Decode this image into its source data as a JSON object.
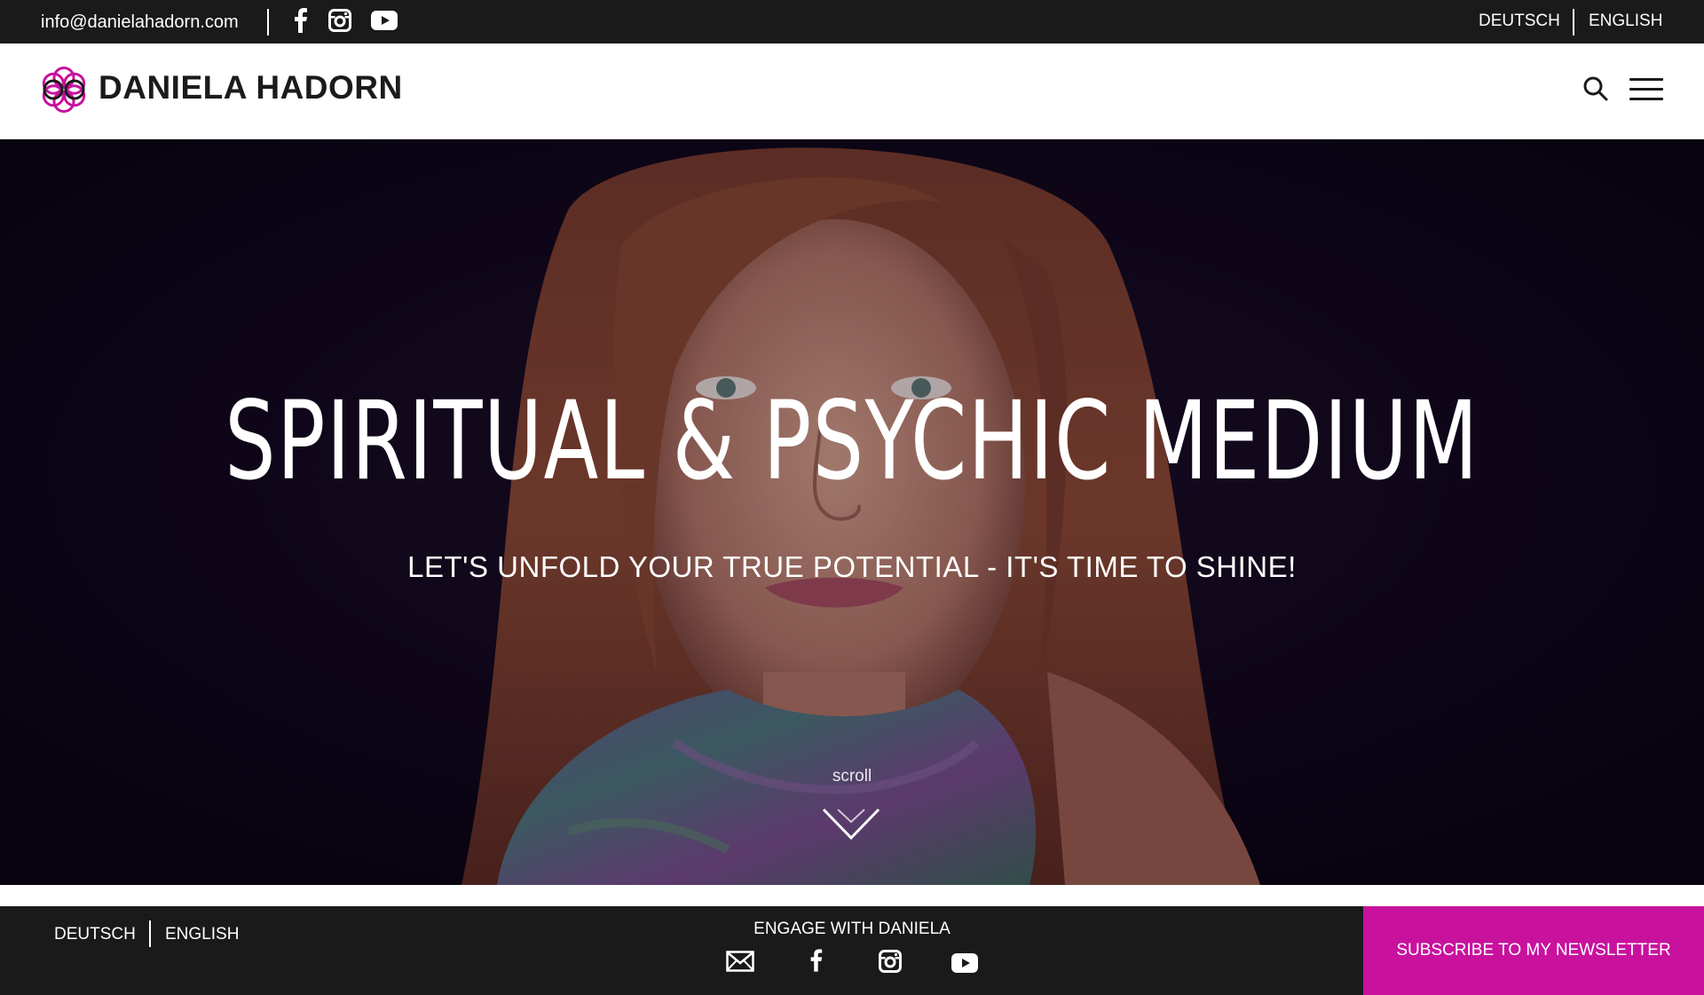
{
  "topbar": {
    "email": "info@danielahadorn.com",
    "social_icons": [
      "facebook-icon",
      "instagram-icon",
      "youtube-icon"
    ],
    "languages": [
      "DEUTSCH",
      "ENGLISH"
    ]
  },
  "header": {
    "brand": "DANIELA HADORN",
    "icons": [
      "flower-logo-icon",
      "search-icon",
      "hamburger-menu-icon"
    ]
  },
  "hero": {
    "title": "SPIRITUAL & PSYCHIC MEDIUM",
    "subtitle": "LET'S UNFOLD YOUR TRUE POTENTIAL - IT'S TIME TO SHINE!",
    "scroll_label": "scroll",
    "scroll_icon": "chevron-down-icon"
  },
  "footer": {
    "languages": [
      "DEUTSCH",
      "ENGLISH"
    ],
    "engage_label": "ENGAGE WITH DANIELA",
    "social_icons": [
      "mail-icon",
      "facebook-icon",
      "instagram-icon",
      "youtube-icon"
    ],
    "newsletter_button": "SUBSCRIBE TO MY NEWSLETTER"
  },
  "colors": {
    "bar_background": "#1a1a1a",
    "accent_magenta": "#c8129e",
    "text_dark": "#1b1b1b",
    "hero_background": "#0c0714"
  }
}
